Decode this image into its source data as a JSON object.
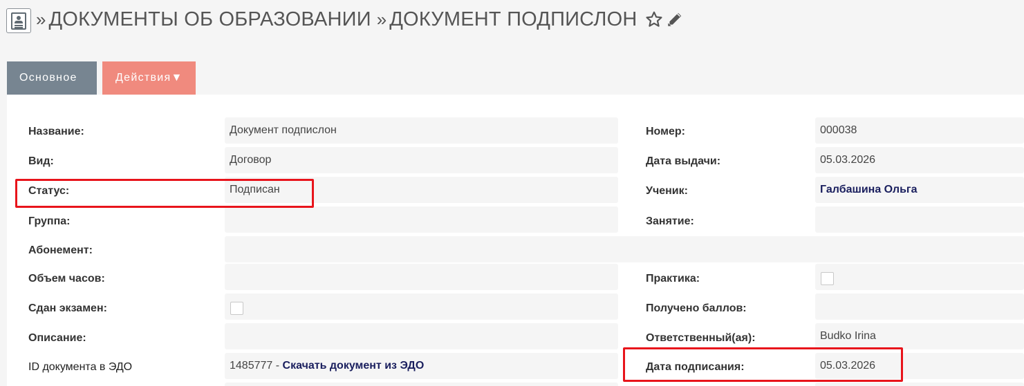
{
  "header": {
    "separator": "»",
    "breadcrumb_module": "ДОКУМЕНТЫ ОБ ОБРАЗОВАНИИ",
    "breadcrumb_record": "ДОКУМЕНТ ПОДПИСЛОН"
  },
  "tabs": {
    "main": "Основное",
    "actions": "Действия▼"
  },
  "left": {
    "name_label": "Название:",
    "name_value": "Документ подпислон",
    "kind_label": "Вид:",
    "kind_value": "Договор",
    "status_label": "Статус:",
    "status_value": "Подписан",
    "group_label": "Группа:",
    "group_value": "",
    "subscription_label": "Абонемент:",
    "subscription_value": "",
    "hours_label": "Объем часов:",
    "hours_value": "",
    "exam_label": "Сдан экзамен:",
    "description_label": "Описание:",
    "description_value": "",
    "edo_label": "ID документа в ЭДО",
    "edo_id": "1485777",
    "edo_dash": "-",
    "edo_link": "Скачать документ из ЭДО"
  },
  "right": {
    "number_label": "Номер:",
    "number_value": "000038",
    "issue_date_label": "Дата выдачи:",
    "issue_date_value": "05.03.2026",
    "student_label": "Ученик:",
    "student_value": "Галбашина Ольга",
    "lesson_label": "Занятие:",
    "lesson_value": "",
    "practice_label": "Практика:",
    "score_label": "Получено баллов:",
    "score_value": "",
    "responsible_label": "Ответственный(ая):",
    "responsible_value": "Budko Irina",
    "signed_date_label": "Дата подписания:",
    "signed_date_value": "05.03.2026"
  },
  "icons": {
    "module": "contact-card-icon",
    "favorite": "star-outline-icon",
    "edit": "pencil-icon"
  },
  "colors": {
    "tab_main": "#778591",
    "tab_actions": "#f08a7e",
    "highlight": "#e8141b",
    "link": "#1a1f5e"
  }
}
